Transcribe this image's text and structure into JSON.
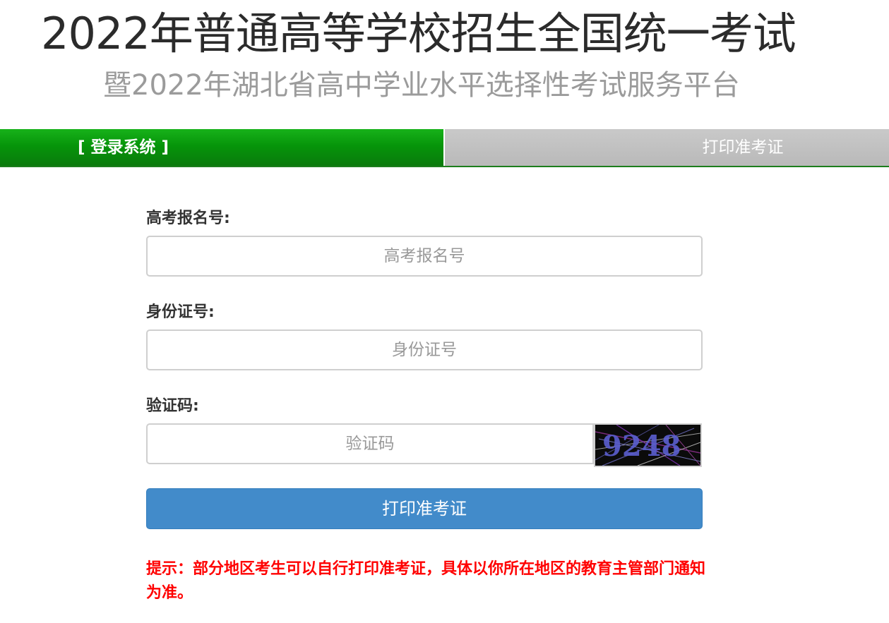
{
  "header": {
    "title": "2022年普通高等学校招生全国统一考试",
    "subtitle": "暨2022年湖北省高中学业水平选择性考试服务平台"
  },
  "tabs": [
    {
      "label": "[ 登录系统 ]",
      "active": true
    },
    {
      "label": "打印准考证",
      "active": false
    }
  ],
  "form": {
    "exam_number": {
      "label": "高考报名号:",
      "placeholder": "高考报名号",
      "value": ""
    },
    "id_number": {
      "label": "身份证号:",
      "placeholder": "身份证号",
      "value": ""
    },
    "captcha": {
      "label": "验证码:",
      "placeholder": "验证码",
      "value": "",
      "image_text": "9248"
    },
    "submit_label": "打印准考证"
  },
  "notice": "提示：部分地区考生可以自行打印准考证，具体以你所在地区的教育主管部门通知为准。",
  "colors": {
    "active_tab": "#069a0a",
    "inactive_tab": "#bdbdbd",
    "submit": "#428bca",
    "notice": "#ff0000"
  }
}
